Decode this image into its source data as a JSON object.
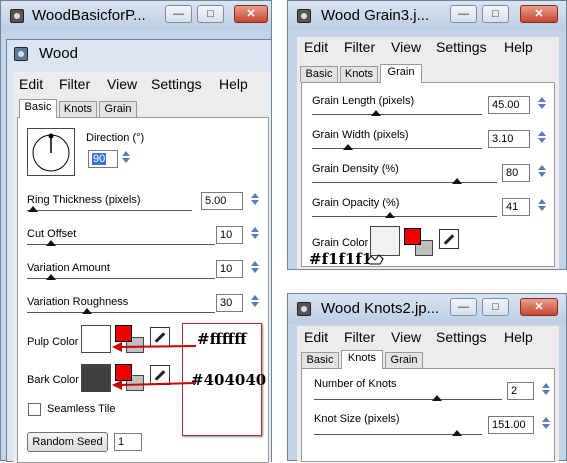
{
  "wood_outer": {
    "title": "WoodBasicforP..."
  },
  "wood_dialog": {
    "title": "Wood",
    "menu": [
      "Edit",
      "Filter",
      "View",
      "Settings",
      "Help"
    ],
    "tabs": [
      "Basic",
      "Knots",
      "Grain"
    ],
    "direction_label": "Direction (°)",
    "direction_value": "90",
    "ring_label": "Ring Thickness (pixels)",
    "ring_value": "5.00",
    "cut_label": "Cut Offset",
    "cut_value": "10",
    "var_amount_label": "Variation Amount",
    "var_amount_value": "10",
    "var_rough_label": "Variation Roughness",
    "var_rough_value": "30",
    "pulp_label": "Pulp Color",
    "bark_label": "Bark Color",
    "seamless_label": "Seamless Tile",
    "seamless_checked": false,
    "random_seed_label": "Random Seed",
    "random_seed_value": "1"
  },
  "annotation": {
    "pulp_hex": "#ffffff",
    "bark_hex": "#404040",
    "grain_hex": "#f1f1f1"
  },
  "grain_window": {
    "title": "Wood Grain3.j...",
    "menu": [
      "Edit",
      "Filter",
      "View",
      "Settings",
      "Help"
    ],
    "tabs": [
      "Basic",
      "Knots",
      "Grain"
    ],
    "length_label": "Grain Length (pixels)",
    "length_value": "45.00",
    "width_label": "Grain Width (pixels)",
    "width_value": "3.10",
    "density_label": "Grain Density (%)",
    "density_value": "80",
    "opacity_label": "Grain Opacity (%)",
    "opacity_value": "41",
    "color_label": "Grain Color"
  },
  "knots_window": {
    "title": "Wood Knots2.jp...",
    "menu": [
      "Edit",
      "Filter",
      "View",
      "Settings",
      "Help"
    ],
    "tabs": [
      "Basic",
      "Knots",
      "Grain"
    ],
    "number_label": "Number of Knots",
    "number_value": "2",
    "size_label": "Knot Size (pixels)",
    "size_value": "151.00"
  },
  "colors": {
    "pulp": "#ffffff",
    "bark": "#404040",
    "grain": "#f1f1f1",
    "accent_red": "#ee0000",
    "arrow": "#cc0000",
    "titlebar": "#c4d3e6"
  },
  "icons": [
    "camera-icon",
    "minimize-icon",
    "maximize-icon",
    "close-icon",
    "eyedropper-icon",
    "hand-cursor-icon"
  ]
}
